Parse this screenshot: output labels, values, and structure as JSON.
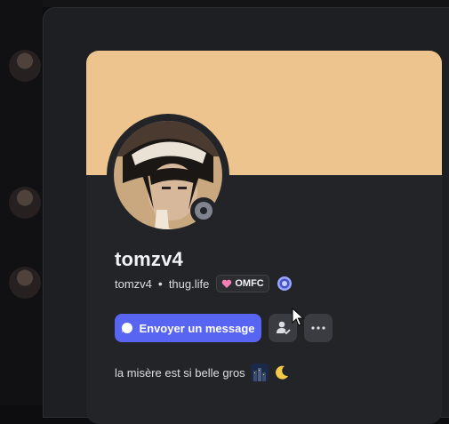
{
  "profile": {
    "display_name": "tomzv4",
    "username": "tomzv4",
    "pronouns": "thug.life",
    "clan_tag": "OMFC",
    "status": "offline",
    "banner_color": "#edc48d",
    "bio": "la misère est si belle gros"
  },
  "actions": {
    "message_label": "Envoyer un message"
  },
  "icons": {
    "status": "offline-status-icon",
    "clan": "heart-icon",
    "badge": "gear-badge-icon",
    "message": "chat-bubble-icon",
    "friend": "add-friend-icon",
    "more": "more-icon",
    "bio_emoji_1": "night-city-emoji",
    "bio_emoji_2": "crescent-moon-emoji"
  }
}
